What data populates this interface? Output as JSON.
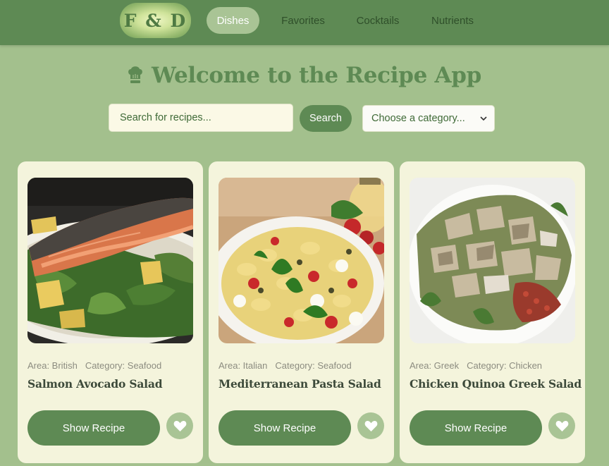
{
  "nav": {
    "logo_text": "F & D",
    "links": [
      "Dishes",
      "Favorites",
      "Cocktails",
      "Nutrients"
    ],
    "active": "Dishes"
  },
  "header": {
    "icon": "chef-hat-icon",
    "title": "Welcome to the Recipe App"
  },
  "search": {
    "placeholder": "Search for recipes...",
    "button_label": "Search",
    "category_selected": "Choose a category..."
  },
  "recipes": [
    {
      "image_icon": "salmon-salad-photo",
      "area": "Area: British",
      "category": "Category: Seafood",
      "title": "Salmon Avocado Salad",
      "button_label": "Show Recipe",
      "fav_icon": "heart-icon"
    },
    {
      "image_icon": "pasta-salad-photo",
      "area": "Area: Italian",
      "category": "Category: Seafood",
      "title": "Mediterranean Pasta Salad",
      "button_label": "Show Recipe",
      "fav_icon": "heart-icon"
    },
    {
      "image_icon": "chicken-quinoa-salad-photo",
      "area": "Area: Greek",
      "category": "Category: Chicken",
      "title": "Chicken Quinoa Greek Salad",
      "button_label": "Show Recipe",
      "fav_icon": "heart-icon"
    }
  ],
  "colors": {
    "page_background": "#a3c08d",
    "navbar": "#5e8a54",
    "accent": "#5e8a54",
    "card": "#f4f4dc",
    "active_pill": "#a9c495"
  }
}
